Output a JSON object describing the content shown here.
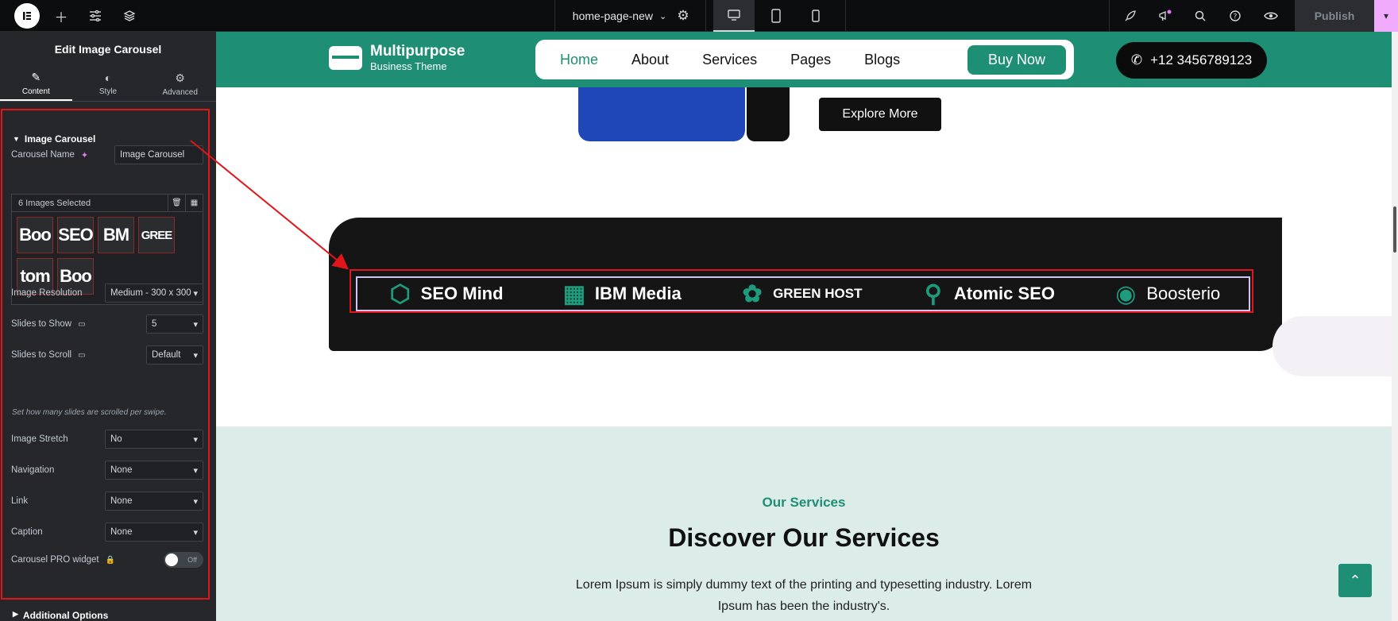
{
  "topbar": {
    "page_name": "home-page-new",
    "publish_label": "Publish"
  },
  "panel": {
    "title": "Edit Image Carousel",
    "tabs": [
      {
        "label": "Content"
      },
      {
        "label": "Style"
      },
      {
        "label": "Advanced"
      }
    ],
    "section_title": "Image Carousel",
    "carousel_name_label": "Carousel Name",
    "carousel_name_value": "Image Carousel",
    "gallery_label": "6 Images Selected",
    "thumbs": [
      "Boo",
      "SEO",
      "BM",
      "GREE",
      "tom",
      "Boo"
    ],
    "image_resolution": {
      "label": "Image Resolution",
      "value": "Medium - 300 x 300"
    },
    "slides_to_show": {
      "label": "Slides to Show",
      "value": "5"
    },
    "slides_to_scroll": {
      "label": "Slides to Scroll",
      "value": "Default"
    },
    "hint": "Set how many slides are scrolled per swipe.",
    "image_stretch": {
      "label": "Image Stretch",
      "value": "No"
    },
    "navigation": {
      "label": "Navigation",
      "value": "None"
    },
    "link": {
      "label": "Link",
      "value": "None"
    },
    "caption": {
      "label": "Caption",
      "value": "None"
    },
    "pro_widget": {
      "label": "Carousel PRO widget",
      "toggle": "Off"
    },
    "additional_options": "Additional Options"
  },
  "site": {
    "brand_name": "Multipurpose",
    "brand_tagline": "Business Theme",
    "nav": [
      "Home",
      "About",
      "Services",
      "Pages",
      "Blogs"
    ],
    "buy_label": "Buy Now",
    "phone": "+12 3456789123",
    "explore_label": "Explore More",
    "logos": [
      "SEO Mind",
      "IBM Media",
      "GREEN HOST",
      "Atomic SEO",
      "Boosterio"
    ],
    "services_kicker": "Our Services",
    "services_title": "Discover Our Services",
    "services_desc": "Lorem Ipsum is simply dummy text of the printing and typesetting industry. Lorem Ipsum has been the industry's."
  },
  "colors": {
    "brand_green": "#1e8e74",
    "panel_bg": "#25272a",
    "highlight_red": "#e0161b"
  }
}
